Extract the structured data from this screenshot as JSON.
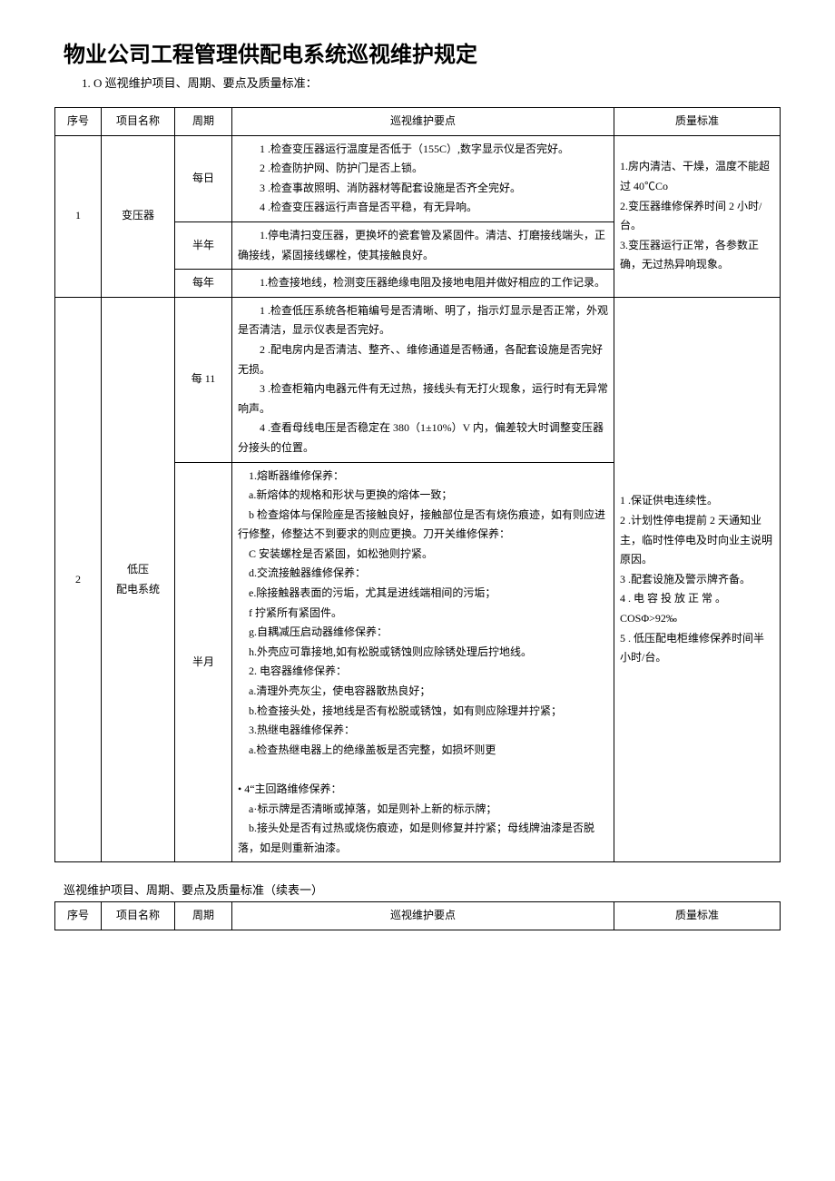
{
  "title": "物业公司工程管理供配电系统巡视维护规定",
  "intro": "1. O 巡视维护项目、周期、要点及质量标准：",
  "headers": {
    "seq": "序号",
    "name": "项目名称",
    "period": "周期",
    "points": "巡视维护要点",
    "std": "质量标准"
  },
  "subtitle": "巡视维护项目、周期、要点及质量标准（续表一）",
  "row1": {
    "seq": "1",
    "name": "变压器",
    "p1": "每日",
    "pts1_a": "1  .检查变压器运行温度是否低于（155C）,数字显示仪是否完好。",
    "pts1_b": "2    .检查防护网、防护门是否上锁。",
    "pts1_c": "3    .检查事故照明、消防器材等配套设施是否齐全完好。",
    "pts1_d": "4    .检查变压器运行声音是否平稳，有无异响。",
    "p2": "半年",
    "pts2": "1.停电清扫变压器，更换坏的瓷套管及紧固件。清洁、打磨接线端头，正确接线，紧固接线螺栓，使其接触良好。",
    "p3": "每年",
    "pts3": "1.检查接地线，检测变压器绝缘电阻及接地电阻并做好相应的工作记录。",
    "std_a": "1.房内清洁、干燥，温度不能超过 40℃Co",
    "std_b": "2.变压器维修保养时间 2 小时/台。",
    "std_c": "3.变压器运行正常，各参数正确，无过热异响现象。"
  },
  "row2": {
    "seq": "2",
    "name_a": "低压",
    "name_b": "配电系统",
    "p1": "每 11",
    "pts1_a": "1  .检查低压系统各柜箱编号是否清晰、明了，指示灯显示是否正常，外观是否清洁，显示仪表是否完好。",
    "pts1_b": "2  .配电房内是否清洁、整齐、、维修通道是否畅通，各配套设施是否完好无损。",
    "pts1_c": "3  .检查柜箱内电器元件有无过热，接线头有无打火现象，运行时有无异常响声。",
    "pts1_d": "4  .查看母线电压是否稳定在 380（1±10%）V 内，偏差较大时调整变压器分接头的位置。",
    "p2": "半月",
    "pts2_a": "1.熔断器维修保养：",
    "pts2_b": "a.新熔体的规格和形状与更换的熔体一致；",
    "pts2_c": "b 检查熔体与保险座是否接触良好，接触部位是否有烧伤痕迹，如有则应进行修整，修整达不到要求的则应更换。刀开关维修保养：",
    "pts2_d": "C 安装螺栓是否紧固，如松弛则拧紧。",
    "pts2_e": "d.交流接触器维修保养：",
    "pts2_f": "e.除接触器表面的污垢，尤其是进线端相间的污垢；",
    "pts2_g": "f 拧紧所有紧固件。",
    "pts2_h": "g.自耦减压启动器维修保养：",
    "pts2_i": "h.外壳应可靠接地,如有松脱或锈蚀则应除锈处理后拧地线。",
    "pts2_j": "2. 电容器维修保养：",
    "pts2_k": "a.清理外壳灰尘，使电容器散热良好；",
    "pts2_l": "b.检查接头处，接地线是否有松脱或锈蚀，如有则应除理并拧紧；",
    "pts2_m": "3.热继电器维修保养：",
    "pts2_n": "a.检查热继电器上的绝缘盖板是否完整，如损坏则更",
    "pts2_o": "•    4“主回路维修保养：",
    "pts2_p": "a·标示牌是否清晰或掉落，如是则补上新的标示牌；",
    "pts2_q": "b.接头处是否有过热或烧伤痕迹，如是则修复并拧紧；母线牌油漆是否脱落，如是则重新油漆。",
    "std_a": "1         .保证供电连续性。",
    "std_b": "2         .计划性停电提前 2 天通知业主，临时性停电及时向业主说明原因。",
    "std_c": "3         .配套设施及警示牌齐备。",
    "std_d": "4         . 电 容 投 放 正 常 。COSΦ>92‰",
    "std_e": "5         . 低压配电柜维修保养时间半小时/台。"
  }
}
